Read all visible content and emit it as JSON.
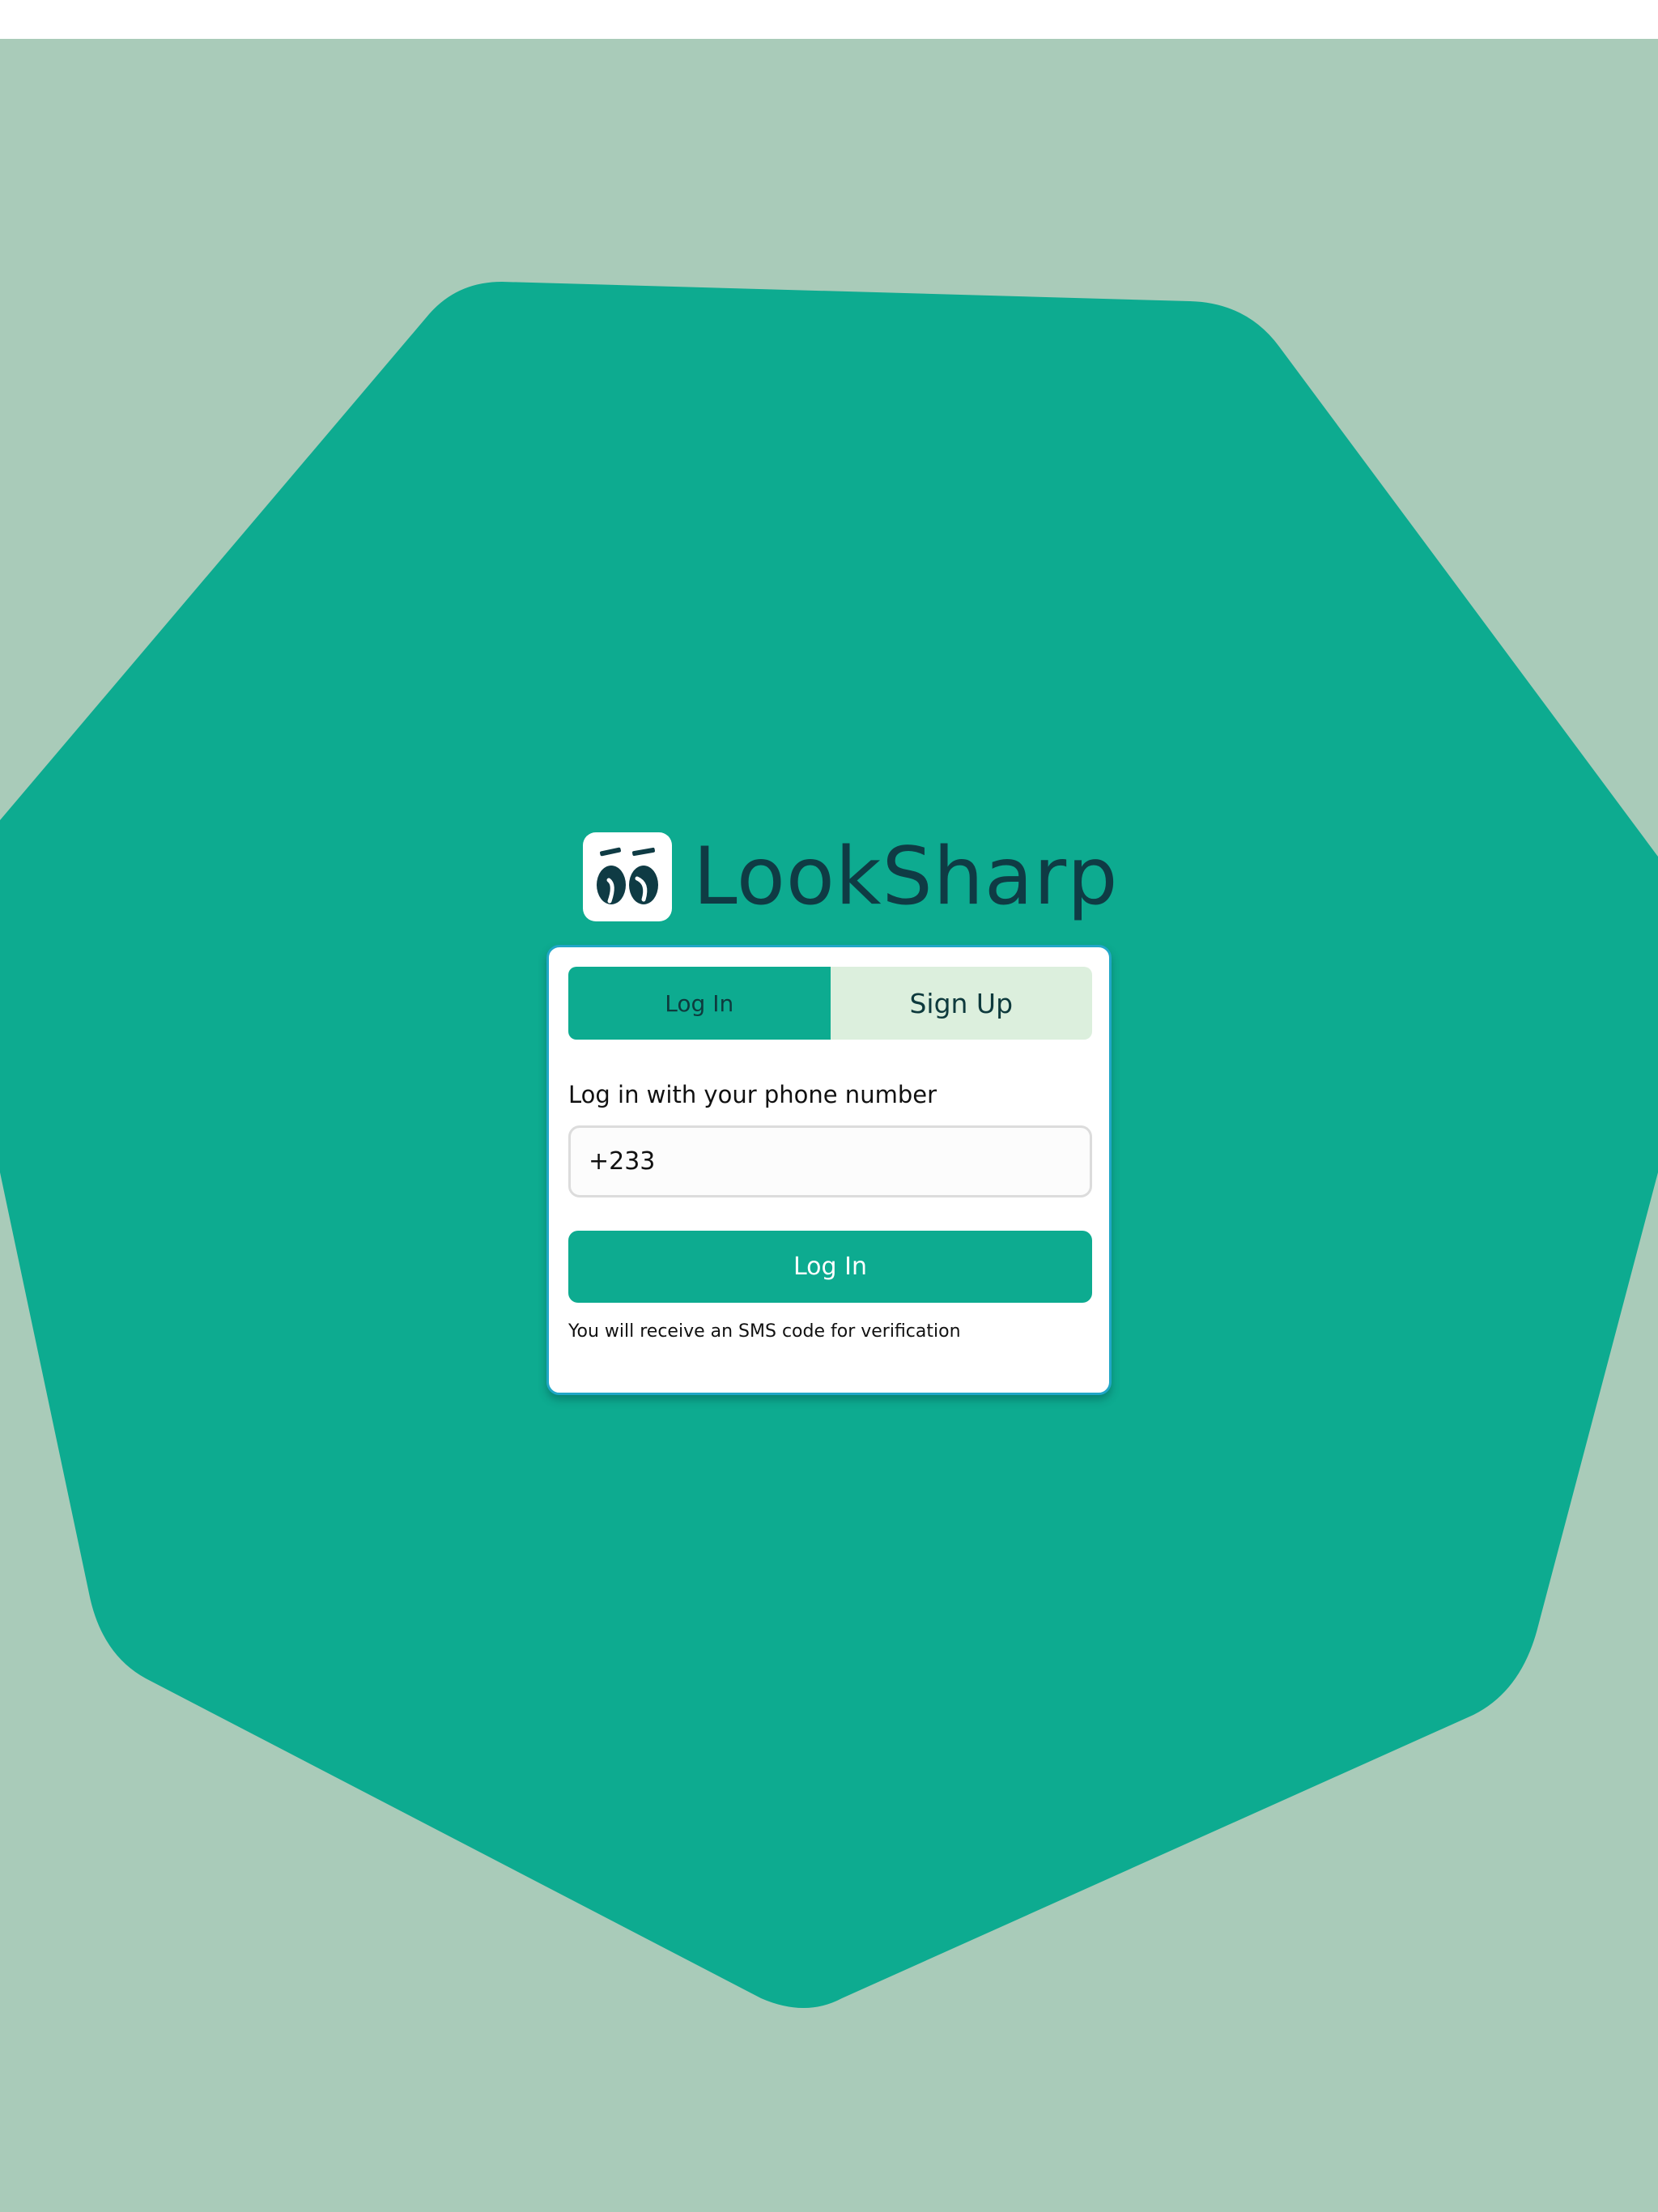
{
  "brand": {
    "name": "LookSharp"
  },
  "tabs": {
    "login_label": "Log In",
    "signup_label": "Sign Up",
    "active": "login"
  },
  "form": {
    "prompt": "Log in with your phone number",
    "phone_value": "+233",
    "submit_label": "Log In",
    "hint": "You will receive an SMS code for verification"
  },
  "colors": {
    "background": "#a9cbb9",
    "accent": "#0dab90",
    "brand_text": "#0f3b44",
    "tab_inactive": "#dcefdd",
    "card_border": "#21a7c7"
  },
  "icons": {
    "logo": "eyes-logo-icon"
  }
}
